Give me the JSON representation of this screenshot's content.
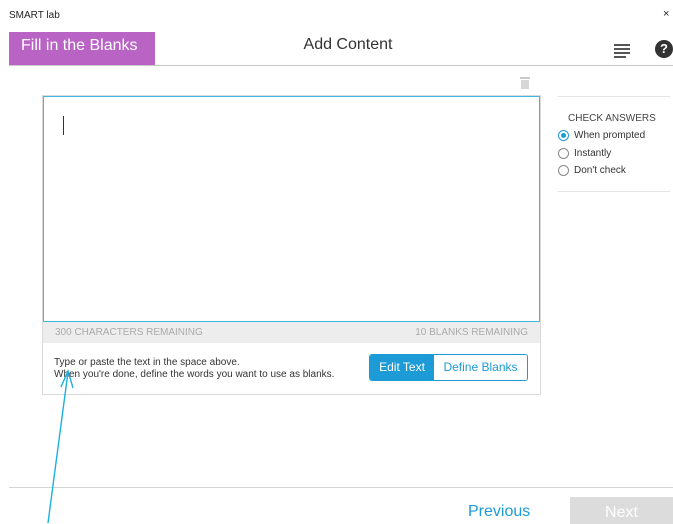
{
  "app": {
    "name": "SMART lab",
    "close_glyph": "×"
  },
  "header": {
    "activity_tab": "Fill in the Blanks",
    "title": "Add Content",
    "help_glyph": "?"
  },
  "editor": {
    "characters_remaining": "300 CHARACTERS REMAINING",
    "blanks_remaining": "10 BLANKS REMAINING",
    "instructions_line1": "Type or paste the text in the space above.",
    "instructions_line2": "When you're done, define the words you want to use as blanks.",
    "edit_text_label": "Edit Text",
    "define_blanks_label": "Define Blanks"
  },
  "check_answers": {
    "title": "CHECK ANSWERS",
    "options": [
      {
        "label": "When prompted",
        "selected": true
      },
      {
        "label": "Instantly",
        "selected": false
      },
      {
        "label": "Don't check",
        "selected": false
      }
    ]
  },
  "footer": {
    "previous_label": "Previous",
    "next_label": "Next"
  },
  "colors": {
    "accent": "#1c9bd6",
    "tab": "#b963c5",
    "editor_border": "#3fb8e0"
  },
  "icons": [
    "menu-icon",
    "help-icon",
    "trash-icon",
    "close-icon"
  ]
}
